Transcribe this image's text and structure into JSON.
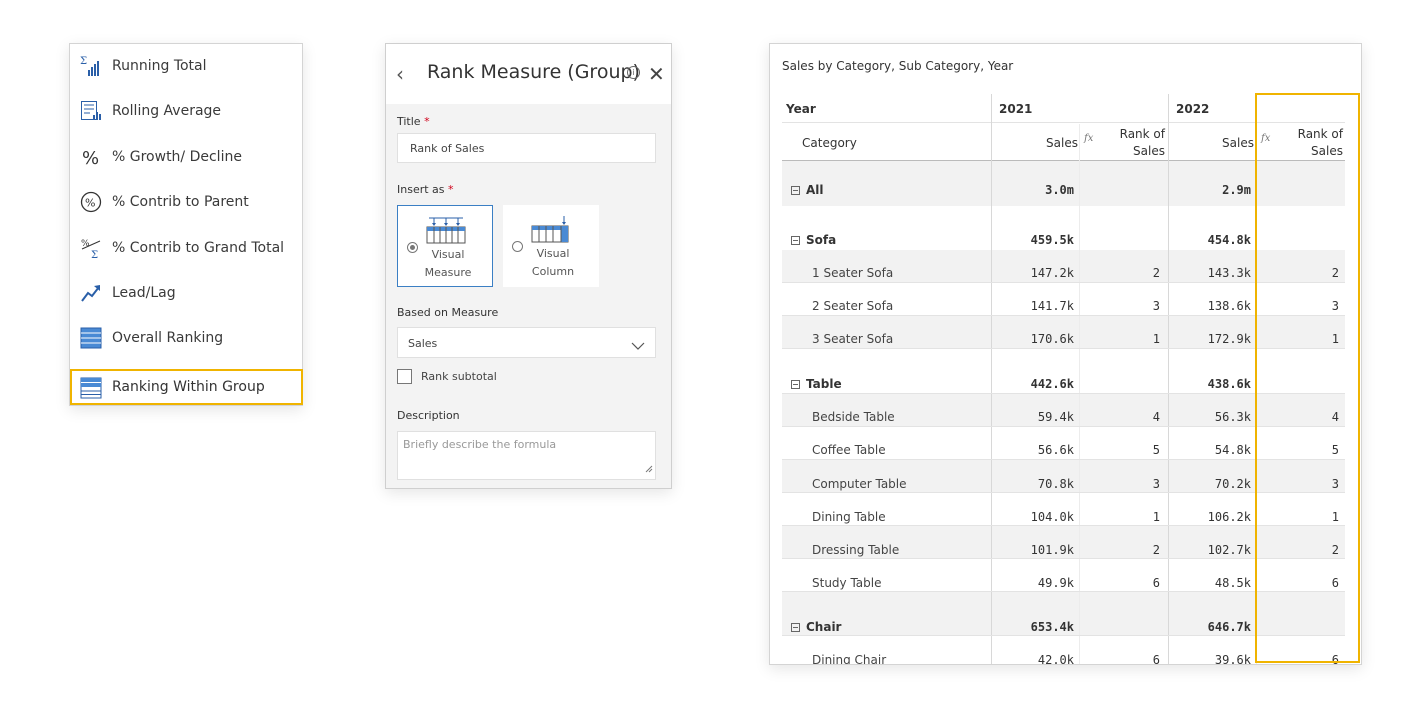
{
  "menu": {
    "items": [
      {
        "label": "Running Total",
        "icon": "running-total-icon"
      },
      {
        "label": "Rolling Average",
        "icon": "rolling-average-icon"
      },
      {
        "label": "% Growth/ Decline",
        "icon": "percent-icon"
      },
      {
        "label": "% Contrib to Parent",
        "icon": "percent-circle-icon"
      },
      {
        "label": "% Contrib to Grand Total",
        "icon": "percent-sigma-icon"
      },
      {
        "label": "Lead/Lag",
        "icon": "trend-arrow-icon"
      },
      {
        "label": "Overall Ranking",
        "icon": "overall-ranking-icon"
      },
      {
        "label": "Ranking Within Group",
        "icon": "ranking-within-group-icon"
      }
    ],
    "selected_index": 7
  },
  "dialog": {
    "title": "Rank Measure (Group)",
    "title_label": "Title",
    "title_value": "Rank of Sales",
    "insert_as_label": "Insert as",
    "required_marker": "*",
    "options": [
      {
        "line1": "Visual",
        "line2": "Measure",
        "selected": true
      },
      {
        "line1": "Visual",
        "line2": "Column",
        "selected": false
      }
    ],
    "based_on_label": "Based on Measure",
    "based_on_value": "Sales",
    "rank_subtotal_label": "Rank subtotal",
    "description_label": "Description",
    "description_placeholder": "Briefly describe the formula",
    "info_glyph": "i"
  },
  "table": {
    "caption": "Sales by Category, Sub Category, Year",
    "year_header": "Year",
    "category_header": "Category",
    "years": [
      "2021",
      "2022"
    ],
    "sales_header": "Sales",
    "rank_header_line1": "Rank of",
    "rank_header_line2": "Sales",
    "fx_label": "fx",
    "rows": [
      {
        "label": "All",
        "group": true,
        "s1": "3.0m",
        "r1": "",
        "s2": "2.9m",
        "r2": ""
      },
      {
        "label": "Sofa",
        "group": true,
        "s1": "459.5k",
        "r1": "",
        "s2": "454.8k",
        "r2": ""
      },
      {
        "label": "1 Seater Sofa",
        "group": false,
        "s1": "147.2k",
        "r1": "2",
        "s2": "143.3k",
        "r2": "2"
      },
      {
        "label": "2 Seater Sofa",
        "group": false,
        "s1": "141.7k",
        "r1": "3",
        "s2": "138.6k",
        "r2": "3"
      },
      {
        "label": "3 Seater Sofa",
        "group": false,
        "s1": "170.6k",
        "r1": "1",
        "s2": "172.9k",
        "r2": "1"
      },
      {
        "label": "Table",
        "group": true,
        "s1": "442.6k",
        "r1": "",
        "s2": "438.6k",
        "r2": ""
      },
      {
        "label": "Bedside Table",
        "group": false,
        "s1": "59.4k",
        "r1": "4",
        "s2": "56.3k",
        "r2": "4"
      },
      {
        "label": "Coffee Table",
        "group": false,
        "s1": "56.6k",
        "r1": "5",
        "s2": "54.8k",
        "r2": "5"
      },
      {
        "label": "Computer Table",
        "group": false,
        "s1": "70.8k",
        "r1": "3",
        "s2": "70.2k",
        "r2": "3"
      },
      {
        "label": "Dining Table",
        "group": false,
        "s1": "104.0k",
        "r1": "1",
        "s2": "106.2k",
        "r2": "1"
      },
      {
        "label": "Dressing Table",
        "group": false,
        "s1": "101.9k",
        "r1": "2",
        "s2": "102.7k",
        "r2": "2"
      },
      {
        "label": "Study Table",
        "group": false,
        "s1": "49.9k",
        "r1": "6",
        "s2": "48.5k",
        "r2": "6"
      },
      {
        "label": "Chair",
        "group": true,
        "s1": "653.4k",
        "r1": "",
        "s2": "646.7k",
        "r2": ""
      },
      {
        "label": "Dining Chair",
        "group": false,
        "s1": "42.0k",
        "r1": "6",
        "s2": "39.6k",
        "r2": "6"
      }
    ]
  },
  "colors": {
    "highlight": "#f0b400",
    "accent": "#3b7fc4",
    "required": "#d0021b"
  }
}
